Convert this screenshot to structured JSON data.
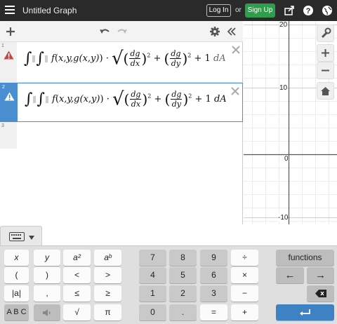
{
  "topbar": {
    "title": "Untitled Graph",
    "login_label": "Log In",
    "or_label": "or",
    "signup_label": "Sign Up"
  },
  "expressions": [
    {
      "number": "1",
      "status": "warning",
      "x_args": "x,y,g(x,y)"
    },
    {
      "number": "2",
      "status": "warning",
      "x_args": "x,y,g(x,y)"
    },
    {
      "number": "3",
      "status": "empty"
    }
  ],
  "math": {
    "f": "f",
    "dg": "dg",
    "dx": "dx",
    "dy": "dy",
    "exp2": "2",
    "plus1": "+ 1",
    "dA": "dA",
    "dot": "·",
    "plus": "+"
  },
  "graph": {
    "y_labels": [
      "20",
      "10",
      "0",
      "-10"
    ],
    "x_label": "0"
  },
  "keypad": {
    "left": [
      [
        "x",
        "y",
        "a²",
        "aᵇ"
      ],
      [
        "(",
        ")",
        "<",
        ">"
      ],
      [
        "|a|",
        ",",
        "≤",
        "≥"
      ],
      [
        "A B C",
        "🔊",
        "√",
        "π"
      ]
    ],
    "middle": [
      [
        "7",
        "8",
        "9",
        "÷"
      ],
      [
        "4",
        "5",
        "6",
        "×"
      ],
      [
        "1",
        "2",
        "3",
        "−"
      ],
      [
        "0",
        ".",
        "=",
        "+"
      ]
    ],
    "functions_label": "functions",
    "left_arrow": "←",
    "right_arrow": "→"
  },
  "colors": {
    "topbar": "#2a2a2a",
    "signup": "#2f9e4a",
    "selected": "#4a8ed0",
    "warning": "#c74440",
    "enter": "#3e82c4"
  }
}
